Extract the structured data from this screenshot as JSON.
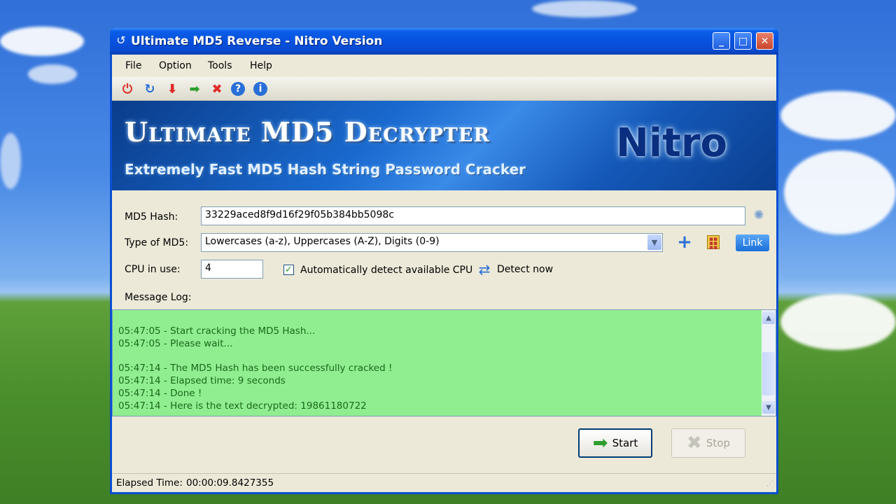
{
  "window": {
    "title": "Ultimate MD5 Reverse - Nitro Version",
    "controls": {
      "minimize": "_",
      "maximize": "□",
      "close": "✕"
    }
  },
  "menu": [
    "File",
    "Option",
    "Tools",
    "Help"
  ],
  "toolbar_icons": [
    "power-icon",
    "refresh-icon",
    "down-arrow-icon",
    "right-arrow-icon",
    "delete-icon",
    "help-icon",
    "info-icon"
  ],
  "banner": {
    "title": "Ultimate MD5 Decrypter",
    "subtitle": "Extremely Fast MD5 Hash String Password Cracker",
    "brand": "Nitro"
  },
  "form": {
    "hash_label": "MD5 Hash:",
    "hash_value": "33229aced8f9d16f29f05b384bb5098c",
    "type_label": "Type of MD5:",
    "type_value": "Lowercases (a-z), Uppercases (A-Z), Digits (0-9)",
    "cpu_label": "CPU in use:",
    "cpu_value": "4",
    "auto_detect_label": "Automatically detect available CPU",
    "auto_detect_checked": true,
    "detect_now_label": "Detect now",
    "link_label": "Link"
  },
  "log": {
    "label": "Message Log:",
    "lines": [
      "05:47:05 - Start cracking the MD5 Hash...",
      "05:47:05 - Please wait...",
      "",
      "05:47:14 - The MD5 Hash has been successfully cracked !",
      "05:47:14 - Elapsed time: 9 seconds",
      "05:47:14 - Done !",
      "05:47:14 - Here is the text decrypted: 19861180722"
    ],
    "background": "#90ee90"
  },
  "buttons": {
    "start": "Start",
    "stop": "Stop"
  },
  "status": {
    "label": "Elapsed Time:",
    "value": "00:00:09.8427355"
  },
  "colors": {
    "titlebar": "#0a5ee8",
    "accent_green": "#21a121",
    "close_red": "#d9342b"
  }
}
